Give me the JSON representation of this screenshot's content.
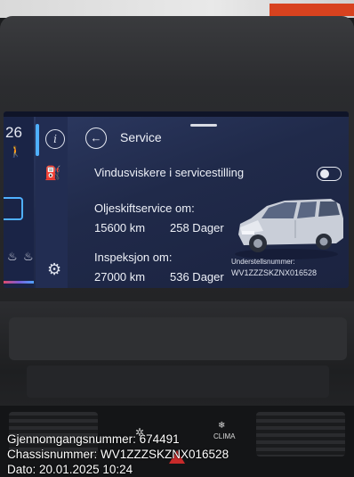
{
  "screen": {
    "time": "26",
    "title": "Service",
    "wiper_label": "Vindusviskere i servicestilling",
    "wiper_toggle_on": false,
    "oil": {
      "label": "Oljeskiftservice om:",
      "km": "15600 km",
      "days": "258 Dager"
    },
    "inspection": {
      "label": "Inspeksjon om:",
      "km": "27000 km",
      "days": "536 Dager"
    },
    "chassis_label": "Understellsnummer:",
    "chassis_value": "WV1ZZZSKZNX016528"
  },
  "dash": {
    "clima_label": "CLIMA"
  },
  "overlay": {
    "line1": "Gjennomgangsnummer: 674491",
    "line2": "Chassisnummer: WV1ZZZSKZNX016528",
    "line3": "Dato: 20.01.2025 10:24"
  },
  "icons": {
    "back": "back-arrow-icon",
    "info": "info-icon",
    "fuel": "fuel-pump-icon",
    "settings": "gear-icon",
    "walk": "pedestrian-icon",
    "seat": "seat-heater-icon",
    "fan": "fan-icon",
    "hazard": "hazard-icon"
  },
  "colors": {
    "screen_bg": "#222b4c",
    "accent_blue": "#4fb0ff",
    "text": "#eef1f8",
    "hazard_red": "#c82a2a"
  }
}
